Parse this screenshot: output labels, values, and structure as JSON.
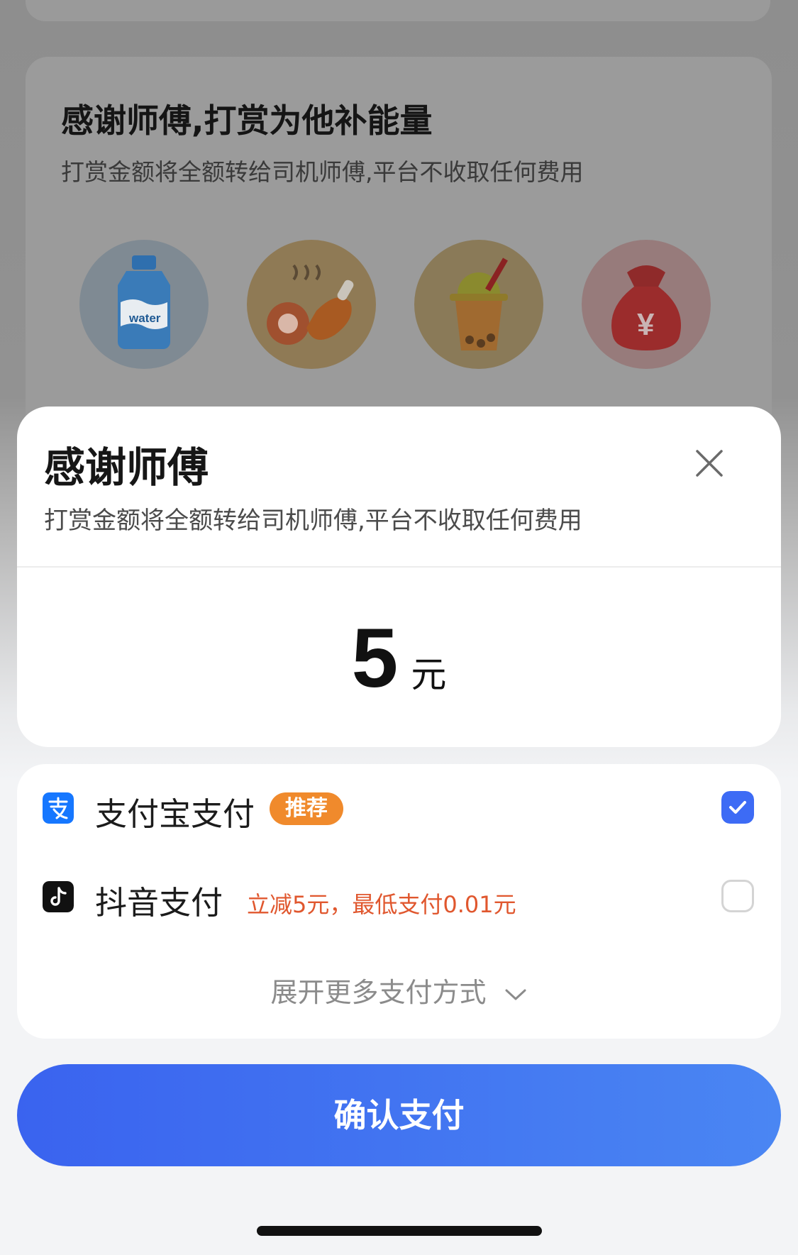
{
  "background": {
    "title": "感谢师傅,打赏为他补能量",
    "subtitle": "打赏金额将全额转给司机师傅,平台不收取任何费用",
    "gifts": [
      {
        "icon": "water-bottle-icon",
        "text": "water"
      },
      {
        "icon": "chicken-leg-icon"
      },
      {
        "icon": "milk-tea-icon"
      },
      {
        "icon": "money-bag-icon",
        "text": "¥"
      }
    ]
  },
  "sheet": {
    "title": "感谢师傅",
    "subtitle": "打赏金额将全额转给司机师傅,平台不收取任何费用",
    "close_icon": "close-icon",
    "amount": "5",
    "unit": "元"
  },
  "payment": {
    "methods": [
      {
        "label": "支付宝支付",
        "badge": "推荐",
        "selected": true,
        "icon": "alipay-icon"
      },
      {
        "label": "抖音支付",
        "promo": "立减5元，最低支付0.01元",
        "selected": false,
        "icon": "douyin-icon"
      }
    ],
    "expand_label": "展开更多支付方式"
  },
  "confirm_label": "确认支付",
  "colors": {
    "primary": "#3D6BF5",
    "badge": "#F08A2C",
    "promo": "#E0572E"
  }
}
